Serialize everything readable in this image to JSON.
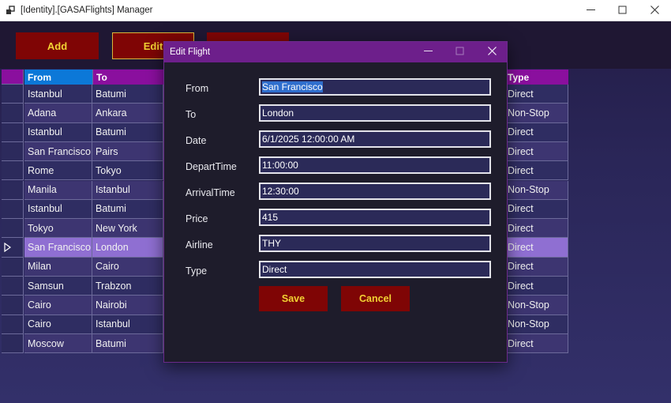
{
  "window": {
    "title": "[Identity].[GASAFlights] Manager"
  },
  "toolbar": {
    "add_label": "Add",
    "edit_label": "Edit",
    "delete_label": ""
  },
  "grid": {
    "columns": {
      "from": "From",
      "to": "To",
      "type": "Type"
    },
    "rows": [
      {
        "from": "Istanbul",
        "to": "Batumi",
        "type": "Direct"
      },
      {
        "from": "Adana",
        "to": "Ankara",
        "type": "Non-Stop"
      },
      {
        "from": "Istanbul",
        "to": "Batumi",
        "type": "Direct"
      },
      {
        "from": "San Francisco",
        "to": "Pairs",
        "type": "Direct"
      },
      {
        "from": "Rome",
        "to": "Tokyo",
        "type": "Direct"
      },
      {
        "from": "Manila",
        "to": "Istanbul",
        "type": "Non-Stop"
      },
      {
        "from": "Istanbul",
        "to": "Batumi",
        "type": "Direct"
      },
      {
        "from": "Tokyo",
        "to": "New York",
        "type": "Direct"
      },
      {
        "from": "San Francisco",
        "to": "London",
        "type": "Direct",
        "selected": true
      },
      {
        "from": "Milan",
        "to": "Cairo",
        "type": "Direct"
      },
      {
        "from": "Samsun",
        "to": "Trabzon",
        "type": "Direct"
      },
      {
        "from": "Cairo",
        "to": "Nairobi",
        "type": "Non-Stop"
      },
      {
        "from": "Cairo",
        "to": "Istanbul",
        "type": "Non-Stop"
      },
      {
        "from": "Moscow",
        "to": "Batumi",
        "type": "Direct"
      }
    ]
  },
  "dialog": {
    "title": "Edit Flight",
    "fields": {
      "from": {
        "label": "From",
        "value": "San Francisco"
      },
      "to": {
        "label": "To",
        "value": "London"
      },
      "date": {
        "label": "Date",
        "value": "6/1/2025 12:00:00 AM"
      },
      "depart": {
        "label": "DepartTime",
        "value": "11:00:00"
      },
      "arrival": {
        "label": "ArrivalTime",
        "value": "12:30:00"
      },
      "price": {
        "label": "Price",
        "value": "415"
      },
      "airline": {
        "label": "Airline",
        "value": "THY"
      },
      "type": {
        "label": "Type",
        "value": "Direct"
      }
    },
    "save_label": "Save",
    "cancel_label": "Cancel"
  },
  "colors": {
    "header_blue": "#0c78d8",
    "header_purple": "#8a0f9e",
    "selected_row": "#8f6fd2",
    "button_red": "#7f0505",
    "button_text": "#f2d233",
    "dialog_title": "#6d1f8b"
  },
  "icons": {
    "app": "app-window-icon",
    "minimize": "minimize-icon",
    "maximize": "maximize-icon",
    "close": "close-icon",
    "row_pointer": "row-pointer-icon"
  }
}
